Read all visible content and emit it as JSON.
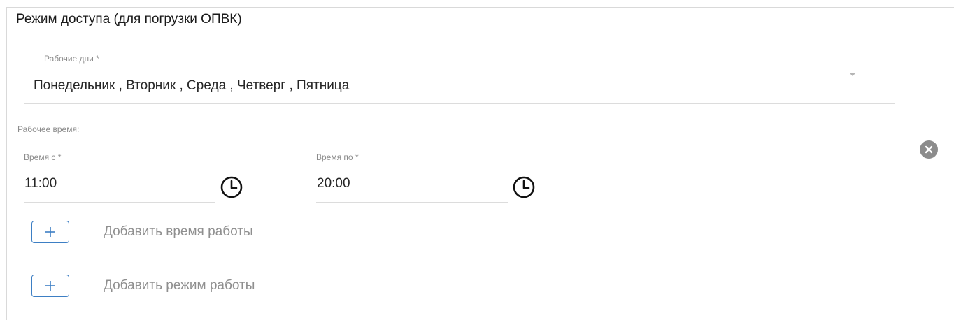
{
  "section": {
    "title": "Режим доступа (для погрузки ОПВК)"
  },
  "workdays": {
    "label": "Рабочие дни *",
    "value": "Понедельник , Вторник , Среда , Четверг , Пятница"
  },
  "worktime": {
    "label": "Рабочее время:",
    "from_label": "Время с *",
    "from_value": "11:00",
    "to_label": "Время по *",
    "to_value": "20:00"
  },
  "actions": {
    "add_time_label": "Добавить время работы",
    "add_mode_label": "Добавить режим работы"
  },
  "colors": {
    "accent": "#3d7fc4",
    "remove_icon": "#8c8c8c"
  },
  "icons": {
    "dropdown": "caret-down-icon",
    "time": "clock-icon",
    "remove": "close-circle-icon",
    "add": "plus-icon"
  }
}
